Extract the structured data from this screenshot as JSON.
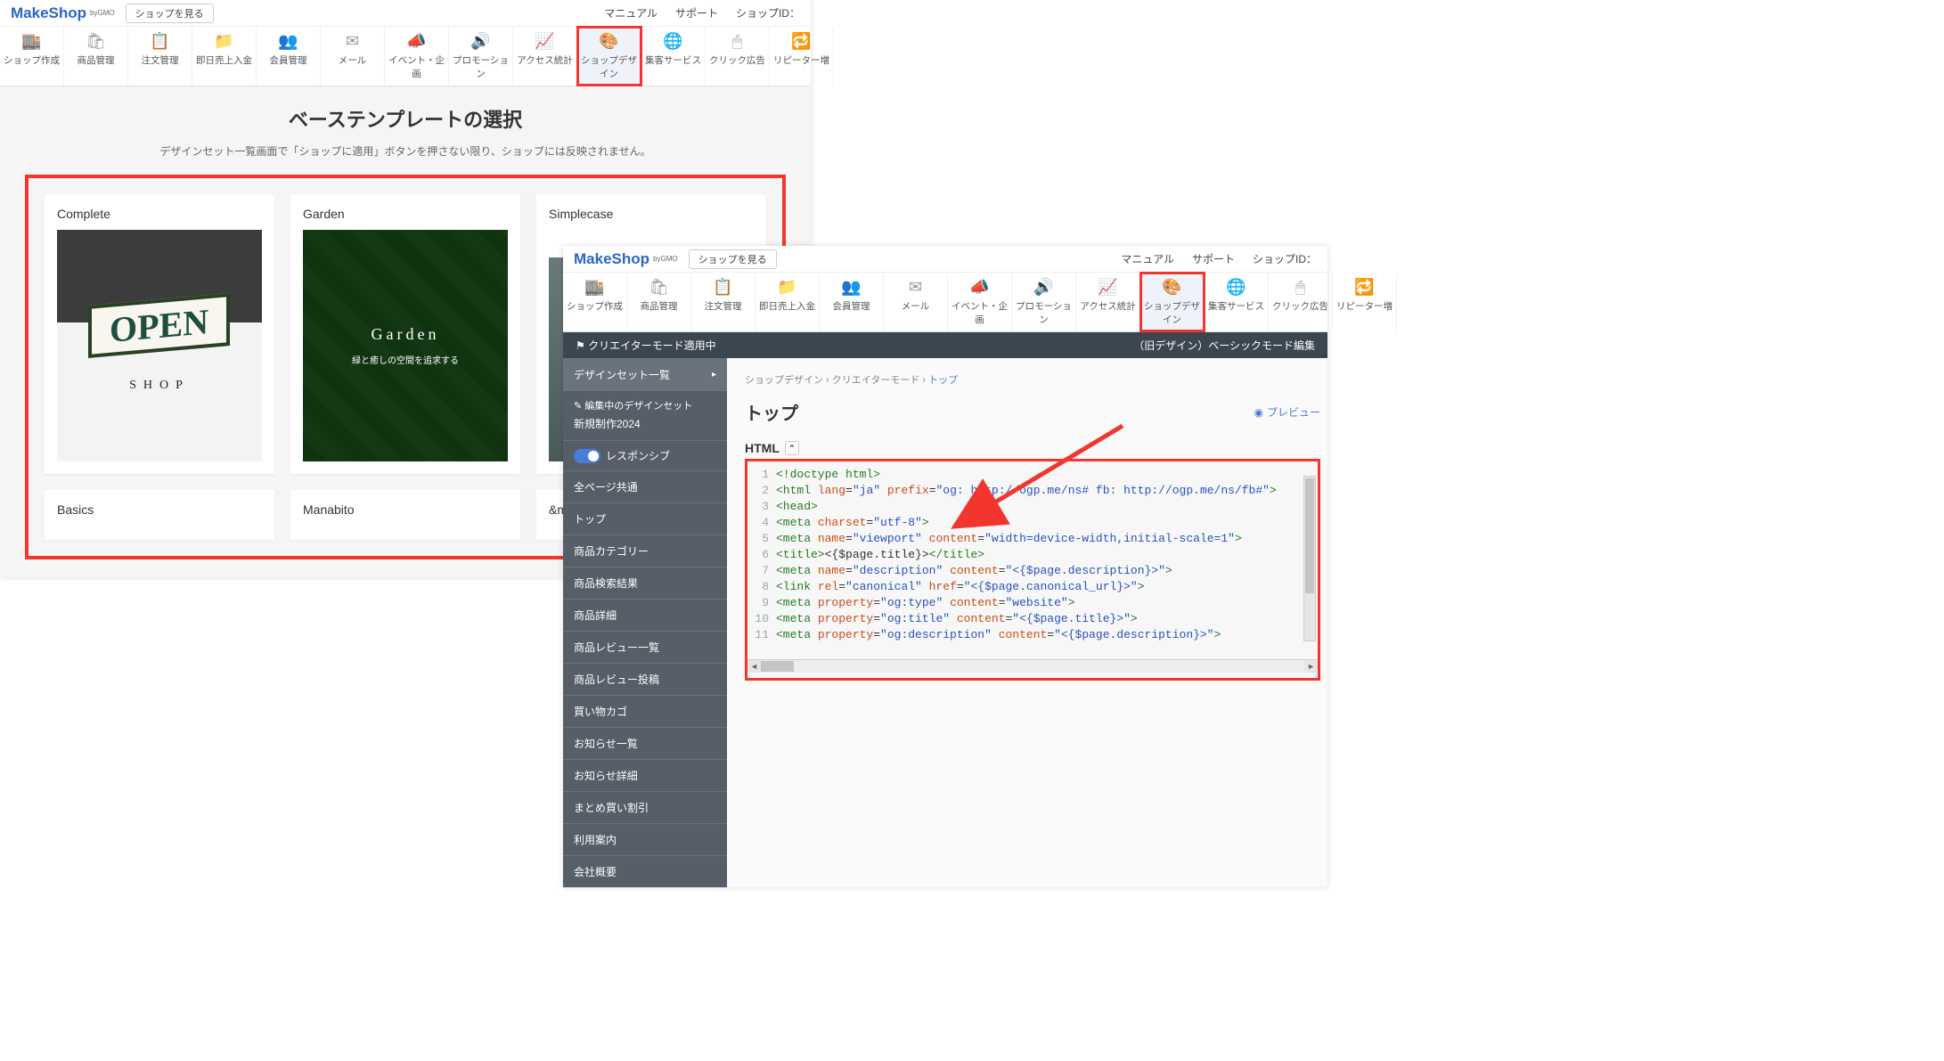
{
  "logo": {
    "main": "MakeShop",
    "sup": "byGMO",
    "view": "ショップを見る"
  },
  "topRight": [
    "マニュアル",
    "サポート",
    "ショップID："
  ],
  "nav": [
    {
      "label": "ショップ作成",
      "icon": "🏬"
    },
    {
      "label": "商品管理",
      "icon": "🛍"
    },
    {
      "label": "注文管理",
      "icon": "📋"
    },
    {
      "label": "即日売上入金",
      "icon": "📁"
    },
    {
      "label": "会員管理",
      "icon": "👥"
    },
    {
      "label": "メール",
      "icon": "✉"
    },
    {
      "label": "イベント・企画",
      "icon": "📣"
    },
    {
      "label": "プロモーション",
      "icon": "🔊"
    },
    {
      "label": "アクセス統計",
      "icon": "📈"
    },
    {
      "label": "ショップデザイン",
      "icon": "🎨"
    },
    {
      "label": "集客サービス",
      "icon": "🌐"
    },
    {
      "label": "クリック広告",
      "icon": "🖱"
    },
    {
      "label": "リピーター増",
      "icon": "🔁"
    }
  ],
  "activeNavIndex": 9,
  "page1": {
    "title": "ベーステンプレートの選択",
    "sub": "デザインセット一覧画面で「ショップに適用」ボタンを押さない限り、ショップには反映されません。",
    "templates_row1": [
      {
        "name": "Complete",
        "preview": "open",
        "line1": "OPEN",
        "line2": "SHOP"
      },
      {
        "name": "Garden",
        "preview": "garden",
        "line1": "Garden",
        "line2": "緑と癒しの空間を追求する"
      },
      {
        "name": "Simplecase",
        "preview": "simple",
        "line1": "",
        "line2": ""
      }
    ],
    "templates_row2": [
      {
        "name": "Basics"
      },
      {
        "name": "Manabito"
      },
      {
        "name": "&m"
      }
    ]
  },
  "page2": {
    "creatorBar": {
      "left": "クリエイターモード適用中",
      "right": "（旧デザイン）ベーシックモード編集"
    },
    "side": {
      "head": "デザインセット一覧",
      "sec": "編集中のデザインセット",
      "name": "新規制作2024",
      "toggle": "レスポンシブ",
      "items": [
        "全ページ共通",
        "トップ",
        "商品カテゴリー",
        "商品検索結果",
        "商品詳細",
        "商品レビュー一覧",
        "商品レビュー投稿",
        "買い物カゴ",
        "お知らせ一覧",
        "お知らせ詳細",
        "まとめ買い割引",
        "利用案内",
        "会社概要"
      ]
    },
    "breadcrumb": [
      "ショップデザイン",
      "クリエイターモード",
      "トップ"
    ],
    "mainTitle": "トップ",
    "preview": "プレビュー",
    "htmlLabel": "HTML",
    "code": [
      [
        [
          "tag",
          "<!doctype html>"
        ]
      ],
      [
        [
          "tag",
          "<html "
        ],
        [
          "attr",
          "lang"
        ],
        [
          "plain",
          "="
        ],
        [
          "val",
          "\"ja\""
        ],
        [
          "plain",
          " "
        ],
        [
          "attr",
          "prefix"
        ],
        [
          "plain",
          "="
        ],
        [
          "val",
          "\"og: http://ogp.me/ns# fb: http://ogp.me/ns/fb#\""
        ],
        [
          "tag",
          ">"
        ]
      ],
      [
        [
          "tag",
          "<head>"
        ]
      ],
      [
        [
          "tag",
          "<meta "
        ],
        [
          "attr",
          "charset"
        ],
        [
          "plain",
          "="
        ],
        [
          "val",
          "\"utf-8\""
        ],
        [
          "tag",
          ">"
        ]
      ],
      [
        [
          "tag",
          "<meta "
        ],
        [
          "attr",
          "name"
        ],
        [
          "plain",
          "="
        ],
        [
          "val",
          "\"viewport\""
        ],
        [
          "plain",
          " "
        ],
        [
          "attr",
          "content"
        ],
        [
          "plain",
          "="
        ],
        [
          "val",
          "\"width=device-width,initial-scale=1\""
        ],
        [
          "tag",
          ">"
        ]
      ],
      [
        [
          "tag",
          "<title>"
        ],
        [
          "plain",
          "<{$page.title}>"
        ],
        [
          "tag",
          "</title>"
        ]
      ],
      [
        [
          "tag",
          "<meta "
        ],
        [
          "attr",
          "name"
        ],
        [
          "plain",
          "="
        ],
        [
          "val",
          "\"description\""
        ],
        [
          "plain",
          " "
        ],
        [
          "attr",
          "content"
        ],
        [
          "plain",
          "="
        ],
        [
          "val",
          "\"<{$page.description}>\""
        ],
        [
          "tag",
          ">"
        ]
      ],
      [
        [
          "tag",
          "<link "
        ],
        [
          "attr",
          "rel"
        ],
        [
          "plain",
          "="
        ],
        [
          "val",
          "\"canonical\""
        ],
        [
          "plain",
          " "
        ],
        [
          "attr",
          "href"
        ],
        [
          "plain",
          "="
        ],
        [
          "val",
          "\"<{$page.canonical_url}>\""
        ],
        [
          "tag",
          ">"
        ]
      ],
      [
        [
          "tag",
          "<meta "
        ],
        [
          "attr",
          "property"
        ],
        [
          "plain",
          "="
        ],
        [
          "val",
          "\"og:type\""
        ],
        [
          "plain",
          " "
        ],
        [
          "attr",
          "content"
        ],
        [
          "plain",
          "="
        ],
        [
          "val",
          "\"website\""
        ],
        [
          "tag",
          ">"
        ]
      ],
      [
        [
          "tag",
          "<meta "
        ],
        [
          "attr",
          "property"
        ],
        [
          "plain",
          "="
        ],
        [
          "val",
          "\"og:title\""
        ],
        [
          "plain",
          " "
        ],
        [
          "attr",
          "content"
        ],
        [
          "plain",
          "="
        ],
        [
          "val",
          "\"<{$page.title}>\""
        ],
        [
          "tag",
          ">"
        ]
      ],
      [
        [
          "tag",
          "<meta "
        ],
        [
          "attr",
          "property"
        ],
        [
          "plain",
          "="
        ],
        [
          "val",
          "\"og:description\""
        ],
        [
          "plain",
          " "
        ],
        [
          "attr",
          "content"
        ],
        [
          "plain",
          "="
        ],
        [
          "val",
          "\"<{$page.description}>\""
        ],
        [
          "tag",
          ">"
        ]
      ]
    ]
  }
}
